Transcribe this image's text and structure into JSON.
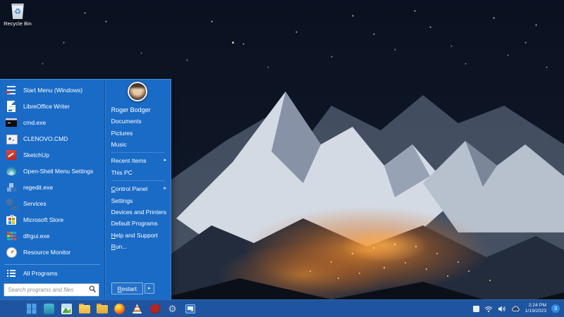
{
  "colors": {
    "menu_bg": "#1a6bc6",
    "taskbar_bg": "#1f55a0",
    "badge_bg": "#2f8ce8",
    "valley_glow": "#f2912f"
  },
  "glyphs": {
    "gear": "⚙",
    "arrow": "▸",
    "recycle": "♻"
  },
  "desktop": {
    "recycle_bin_label": "Recycle Bin"
  },
  "start_menu": {
    "pinned": [
      "Start Menu (Windows)",
      "LibreOffice Writer",
      "cmd.exe",
      "CLENOVO.CMD",
      "SketchUp",
      "Open-Shell Menu Settings",
      "regedit.exe",
      "Services",
      "Microsoft Store",
      "dfrgui.exe",
      "Resource Monitor"
    ],
    "all_programs": "All Programs",
    "search_placeholder": "Search programs and files",
    "user_name": "Roger Bodger",
    "documents": "Documents",
    "pictures": "Pictures",
    "music": "Music",
    "recent_items": "Recent Items",
    "this_pc": "This PC",
    "control_panel": {
      "u": "C",
      "rest": "ontrol Panel"
    },
    "settings": "Settings",
    "devices_printers": "Devices and Printers",
    "default_programs": "Default Programs",
    "help_support": {
      "u": "H",
      "rest": "elp and Support"
    },
    "run": {
      "u": "R",
      "rest": "un..."
    },
    "restart": {
      "u": "R",
      "rest": "estart"
    }
  },
  "taskbar": {
    "icons": [
      "windows-start",
      "teal-app",
      "photos",
      "file-explorer-folder",
      "folder",
      "firefox",
      "vlc",
      "red-app",
      "settings-gear",
      "system-app"
    ],
    "tray": {
      "time": "2:24 PM",
      "date": "1/19/2023",
      "notification_count": "3"
    }
  }
}
